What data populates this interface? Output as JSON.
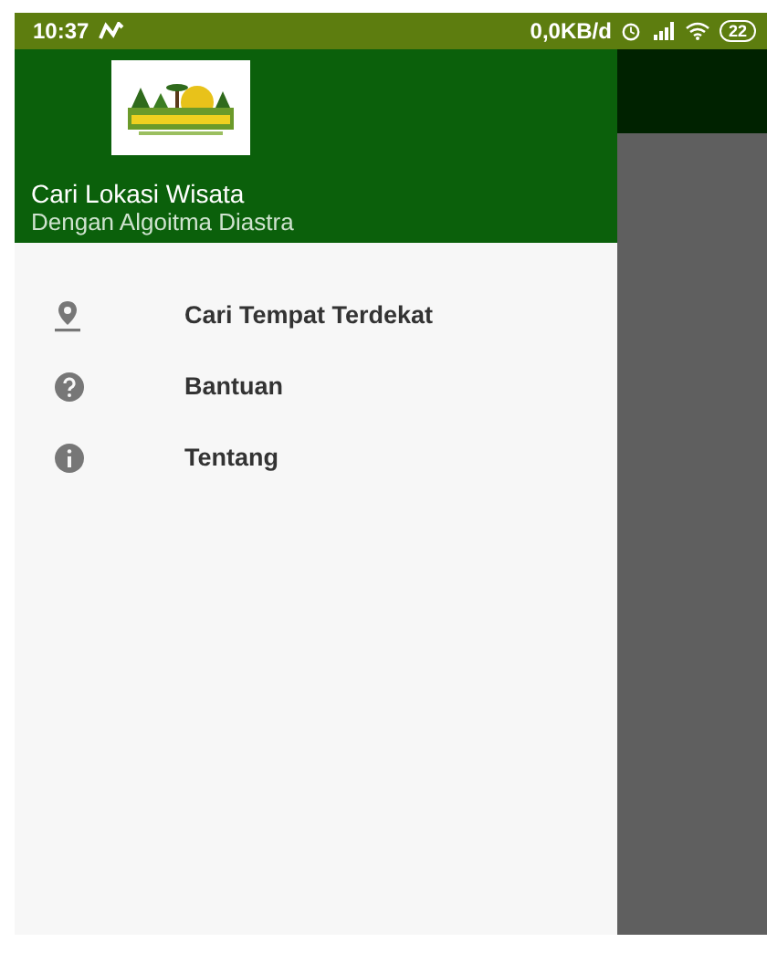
{
  "status_bar": {
    "time": "10:37",
    "speed": "0,0KB/d",
    "battery": "22"
  },
  "drawer": {
    "header": {
      "title": "Cari Lokasi Wisata",
      "subtitle": "Dengan Algoitma Diastra"
    },
    "items": [
      {
        "label": "Cari Tempat Terdekat"
      },
      {
        "label": "Bantuan"
      },
      {
        "label": "Tentang"
      }
    ]
  }
}
